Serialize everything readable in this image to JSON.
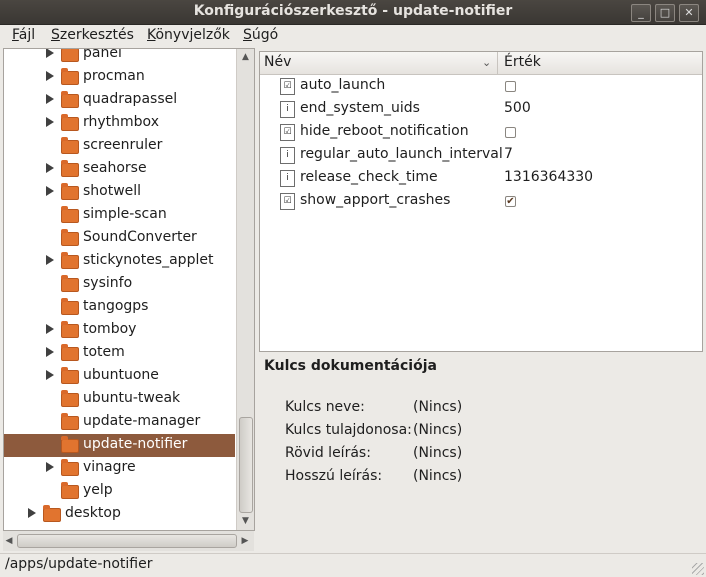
{
  "window": {
    "title": "Konfigurációszerkesztő - update-notifier"
  },
  "window_buttons": [
    "_",
    "□",
    "✕"
  ],
  "menu": [
    {
      "mn": "F",
      "rest": "ájl"
    },
    {
      "mn": "S",
      "rest": "zerkesztés"
    },
    {
      "mn": "K",
      "rest": "önyvjelzők"
    },
    {
      "mn": "S",
      "rest": "úgó"
    }
  ],
  "tree": [
    {
      "label": "panel",
      "expander": true,
      "depth": 2
    },
    {
      "label": "procman",
      "expander": true,
      "depth": 2
    },
    {
      "label": "quadrapassel",
      "expander": true,
      "depth": 2
    },
    {
      "label": "rhythmbox",
      "expander": true,
      "depth": 2
    },
    {
      "label": "screenruler",
      "expander": false,
      "depth": 2
    },
    {
      "label": "seahorse",
      "expander": true,
      "depth": 2
    },
    {
      "label": "shotwell",
      "expander": true,
      "depth": 2
    },
    {
      "label": "simple-scan",
      "expander": false,
      "depth": 2
    },
    {
      "label": "SoundConverter",
      "expander": false,
      "depth": 2
    },
    {
      "label": "stickynotes_applet",
      "expander": true,
      "depth": 2
    },
    {
      "label": "sysinfo",
      "expander": false,
      "depth": 2
    },
    {
      "label": "tangogps",
      "expander": false,
      "depth": 2
    },
    {
      "label": "tomboy",
      "expander": true,
      "depth": 2
    },
    {
      "label": "totem",
      "expander": true,
      "depth": 2
    },
    {
      "label": "ubuntuone",
      "expander": true,
      "depth": 2
    },
    {
      "label": "ubuntu-tweak",
      "expander": false,
      "depth": 2
    },
    {
      "label": "update-manager",
      "expander": false,
      "depth": 2
    },
    {
      "label": "update-notifier",
      "expander": false,
      "depth": 2,
      "selected": true
    },
    {
      "label": "vinagre",
      "expander": true,
      "depth": 2
    },
    {
      "label": "yelp",
      "expander": false,
      "depth": 2
    },
    {
      "label": "desktop",
      "expander": true,
      "depth": 1
    }
  ],
  "table": {
    "col_name": "Név",
    "col_value": "Érték",
    "rows": [
      {
        "name": "auto_launch",
        "type": "bool",
        "value": "",
        "checked": false
      },
      {
        "name": "end_system_uids",
        "type": "int",
        "value": "500"
      },
      {
        "name": "hide_reboot_notification",
        "type": "bool",
        "value": "",
        "checked": false
      },
      {
        "name": "regular_auto_launch_interval",
        "type": "int",
        "value": "7"
      },
      {
        "name": "release_check_time",
        "type": "int",
        "value": "1316364330"
      },
      {
        "name": "show_apport_crashes",
        "type": "bool",
        "value": "",
        "checked": true
      }
    ]
  },
  "docs": {
    "title": "Kulcs dokumentációja",
    "fields": [
      {
        "label": "Kulcs neve:",
        "value": "(Nincs)"
      },
      {
        "label": "Kulcs tulajdonosa:",
        "value": "(Nincs)"
      },
      {
        "label": "Rövid leírás:",
        "value": "(Nincs)"
      },
      {
        "label": "Hosszú leírás:",
        "value": "(Nincs)"
      }
    ]
  },
  "status": {
    "path": "/apps/update-notifier"
  },
  "colors": {
    "selection": "#8d5a3d",
    "folder": "#e1742f",
    "titlebar": "#3a3733"
  }
}
